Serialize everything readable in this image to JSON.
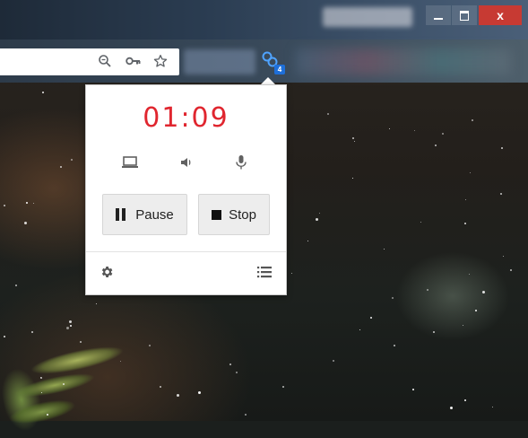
{
  "window": {
    "minimize_label": "–",
    "close_label": "x"
  },
  "toolbar": {
    "omnibox_icons": [
      "zoom-icon",
      "key-icon",
      "star-icon"
    ],
    "extension_badge": "4"
  },
  "recorder": {
    "timer": "01:09",
    "timer_color": "#e0262f",
    "sources": [
      "screen-icon",
      "system-audio-icon",
      "microphone-icon"
    ],
    "pause_label": "Pause",
    "stop_label": "Stop",
    "footer_icons": [
      "settings-icon",
      "recordings-list-icon"
    ]
  }
}
